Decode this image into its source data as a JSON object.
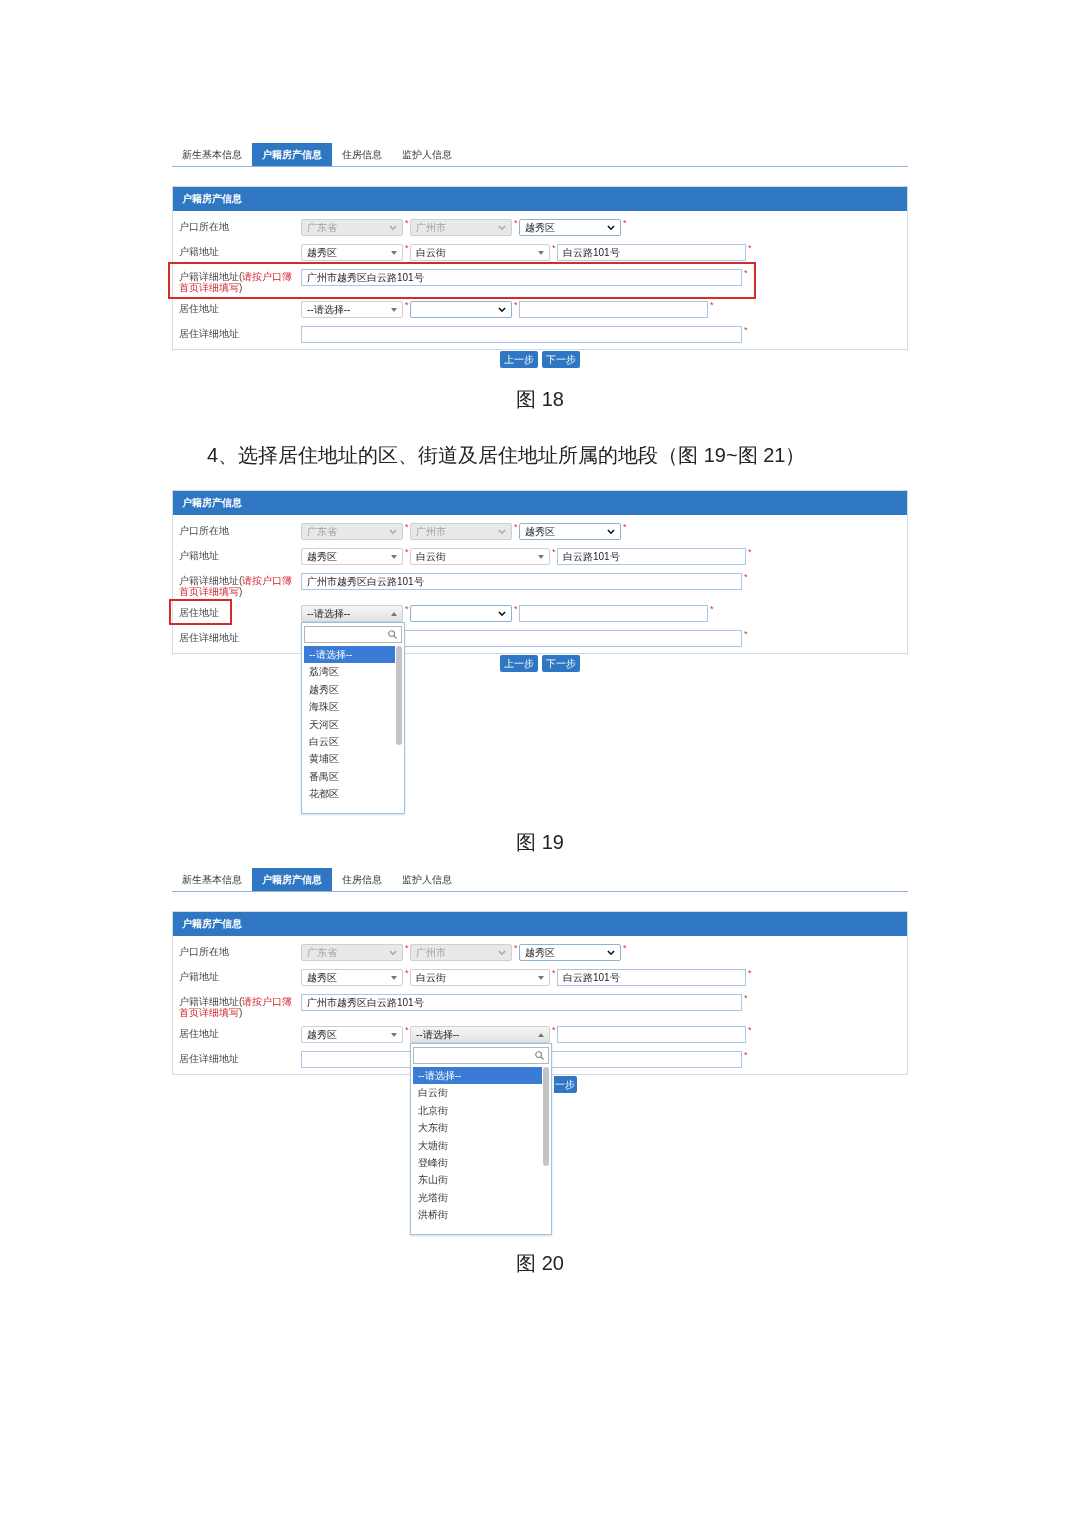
{
  "blocks": [
    {
      "kind": "figure",
      "tabs": [
        {
          "label": "新生基本信息",
          "selected": false
        },
        {
          "label": "户籍房产信息",
          "selected": true
        },
        {
          "label": "住房信息",
          "selected": false
        },
        {
          "label": "监护人信息",
          "selected": false
        }
      ],
      "panel_title": "户籍房产信息",
      "rows": [
        {
          "label": "户口所在地",
          "highlighted": false,
          "label_highlighted": false,
          "fields": [
            {
              "kind": "select",
              "value": "广东省",
              "disabled": true,
              "mark": "*"
            },
            {
              "kind": "select",
              "value": "广州市",
              "disabled": true,
              "mark": "*"
            },
            {
              "kind": "select",
              "value": "越秀区",
              "disabled": false,
              "mark": "*"
            }
          ]
        },
        {
          "label": "户籍地址",
          "highlighted": false,
          "label_highlighted": false,
          "fields": [
            {
              "kind": "combo",
              "value": "越秀区",
              "disabled": false,
              "open": false,
              "mark": "*"
            },
            {
              "kind": "combo",
              "value": "白云街",
              "disabled": false,
              "open": false,
              "mark": "*"
            },
            {
              "kind": "text",
              "value": "白云路101号",
              "disabled": false,
              "mark": "*"
            }
          ]
        },
        {
          "label": "户籍详细地址(",
          "note": "请按户口簿首页详细填写",
          "label_end": ")",
          "highlighted": true,
          "label_highlighted": false,
          "fields": [
            {
              "kind": "text",
              "value": "广州市越秀区白云路101号",
              "disabled": false,
              "mark": "*"
            }
          ]
        },
        {
          "label": "居住地址",
          "highlighted": false,
          "label_highlighted": false,
          "fields": [
            {
              "kind": "combo",
              "value": "--请选择--",
              "disabled": false,
              "open": false,
              "mark": "*"
            },
            {
              "kind": "select",
              "disabled": false,
              "mark": "*"
            },
            {
              "kind": "text",
              "disabled": false,
              "mark": "*"
            }
          ]
        },
        {
          "label": "居住详细地址",
          "highlighted": false,
          "label_highlighted": false,
          "fields": [
            {
              "kind": "text",
              "disabled": false,
              "mark": "*"
            }
          ]
        }
      ],
      "buttons": [
        {
          "label": "上一步",
          "kind": "prev"
        },
        {
          "label": "下一步",
          "kind": "next"
        }
      ],
      "caption": "图 18"
    },
    {
      "kind": "heading",
      "text": "4、选择居住地址的区、街道及居住地址所属的地段（图 19~图 21）"
    },
    {
      "kind": "figure",
      "panel_title": "户籍房产信息",
      "rows": [
        {
          "label": "户口所在地",
          "highlighted": false,
          "label_highlighted": false,
          "fields": [
            {
              "kind": "select",
              "value": "广东省",
              "disabled": true,
              "mark": "*"
            },
            {
              "kind": "select",
              "value": "广州市",
              "disabled": true,
              "mark": "*"
            },
            {
              "kind": "select",
              "value": "越秀区",
              "disabled": false,
              "mark": "*"
            }
          ]
        },
        {
          "label": "户籍地址",
          "highlighted": false,
          "label_highlighted": false,
          "fields": [
            {
              "kind": "combo",
              "value": "越秀区",
              "disabled": false,
              "open": false,
              "mark": "*"
            },
            {
              "kind": "combo",
              "value": "白云街",
              "disabled": false,
              "open": false,
              "mark": "*"
            },
            {
              "kind": "text",
              "value": "白云路101号",
              "disabled": false,
              "mark": "*"
            }
          ]
        },
        {
          "label": "户籍详细地址(",
          "note": "请按户口簿首页详细填写",
          "label_end": ")",
          "highlighted": false,
          "label_highlighted": false,
          "fields": [
            {
              "kind": "text",
              "value": "广州市越秀区白云路101号",
              "disabled": false,
              "mark": "*"
            }
          ]
        },
        {
          "label": "居住地址",
          "highlighted": false,
          "label_highlighted": true,
          "fields": [
            {
              "kind": "combo",
              "value": "--请选择--",
              "disabled": false,
              "open": true,
              "mark": "*",
              "options": [
                {
                  "label": "--请选择--",
                  "selected": true
                },
                {
                  "label": "荔湾区",
                  "selected": false
                },
                {
                  "label": "越秀区",
                  "selected": false
                },
                {
                  "label": "海珠区",
                  "selected": false
                },
                {
                  "label": "天河区",
                  "selected": false
                },
                {
                  "label": "白云区",
                  "selected": false
                },
                {
                  "label": "黄埔区",
                  "selected": false
                },
                {
                  "label": "番禺区",
                  "selected": false
                },
                {
                  "label": "花都区",
                  "selected": false
                }
              ]
            },
            {
              "kind": "select",
              "disabled": false,
              "mark": "*"
            },
            {
              "kind": "text",
              "disabled": false,
              "mark": "*"
            }
          ]
        },
        {
          "label": "居住详细地址",
          "highlighted": false,
          "label_highlighted": false,
          "fields": [
            {
              "kind": "text",
              "disabled": false,
              "mark": "*"
            }
          ]
        }
      ],
      "buttons": [
        {
          "label": "上一步",
          "kind": "prev"
        },
        {
          "label": "下一步",
          "kind": "next"
        }
      ],
      "caption": "图 19"
    },
    {
      "kind": "figure",
      "tabs": [
        {
          "label": "新生基本信息",
          "selected": false
        },
        {
          "label": "户籍房产信息",
          "selected": true
        },
        {
          "label": "住房信息",
          "selected": false
        },
        {
          "label": "监护人信息",
          "selected": false
        }
      ],
      "panel_title": "户籍房产信息",
      "rows": [
        {
          "label": "户口所在地",
          "highlighted": false,
          "label_highlighted": false,
          "fields": [
            {
              "kind": "select",
              "value": "广东省",
              "disabled": true,
              "mark": "*"
            },
            {
              "kind": "select",
              "value": "广州市",
              "disabled": true,
              "mark": "*"
            },
            {
              "kind": "select",
              "value": "越秀区",
              "disabled": false,
              "mark": "*"
            }
          ]
        },
        {
          "label": "户籍地址",
          "highlighted": false,
          "label_highlighted": false,
          "fields": [
            {
              "kind": "combo",
              "value": "越秀区",
              "disabled": false,
              "open": false,
              "mark": "*"
            },
            {
              "kind": "combo",
              "value": "白云街",
              "disabled": false,
              "open": false,
              "mark": "*"
            },
            {
              "kind": "text",
              "value": "白云路101号",
              "disabled": false,
              "mark": "*"
            }
          ]
        },
        {
          "label": "户籍详细地址(",
          "note": "请按户口簿首页详细填写",
          "label_end": ")",
          "highlighted": false,
          "label_highlighted": false,
          "fields": [
            {
              "kind": "text",
              "value": "广州市越秀区白云路101号",
              "disabled": false,
              "mark": "*"
            }
          ]
        },
        {
          "label": "居住地址",
          "highlighted": false,
          "label_highlighted": false,
          "fields": [
            {
              "kind": "combo",
              "value": "越秀区",
              "disabled": false,
              "open": false,
              "mark": "*"
            },
            {
              "kind": "combo",
              "value": "--请选择--",
              "disabled": false,
              "open": true,
              "mark": "*",
              "options": [
                {
                  "label": "--请选择--",
                  "selected": true
                },
                {
                  "label": "白云街",
                  "selected": false
                },
                {
                  "label": "北京街",
                  "selected": false
                },
                {
                  "label": "大东街",
                  "selected": false
                },
                {
                  "label": "大塘街",
                  "selected": false
                },
                {
                  "label": "登峰街",
                  "selected": false
                },
                {
                  "label": "东山街",
                  "selected": false
                },
                {
                  "label": "光塔街",
                  "selected": false
                },
                {
                  "label": "洪桥街",
                  "selected": false
                }
              ]
            },
            {
              "kind": "text",
              "disabled": false,
              "mark": "*"
            }
          ]
        },
        {
          "label": "居住详细地址",
          "highlighted": false,
          "label_highlighted": false,
          "fields": [
            {
              "kind": "text",
              "disabled": false,
              "mark": "*"
            }
          ]
        }
      ],
      "buttons": [
        {
          "label": "一步",
          "kind": "next_cut"
        }
      ],
      "caption": "图 20"
    }
  ]
}
